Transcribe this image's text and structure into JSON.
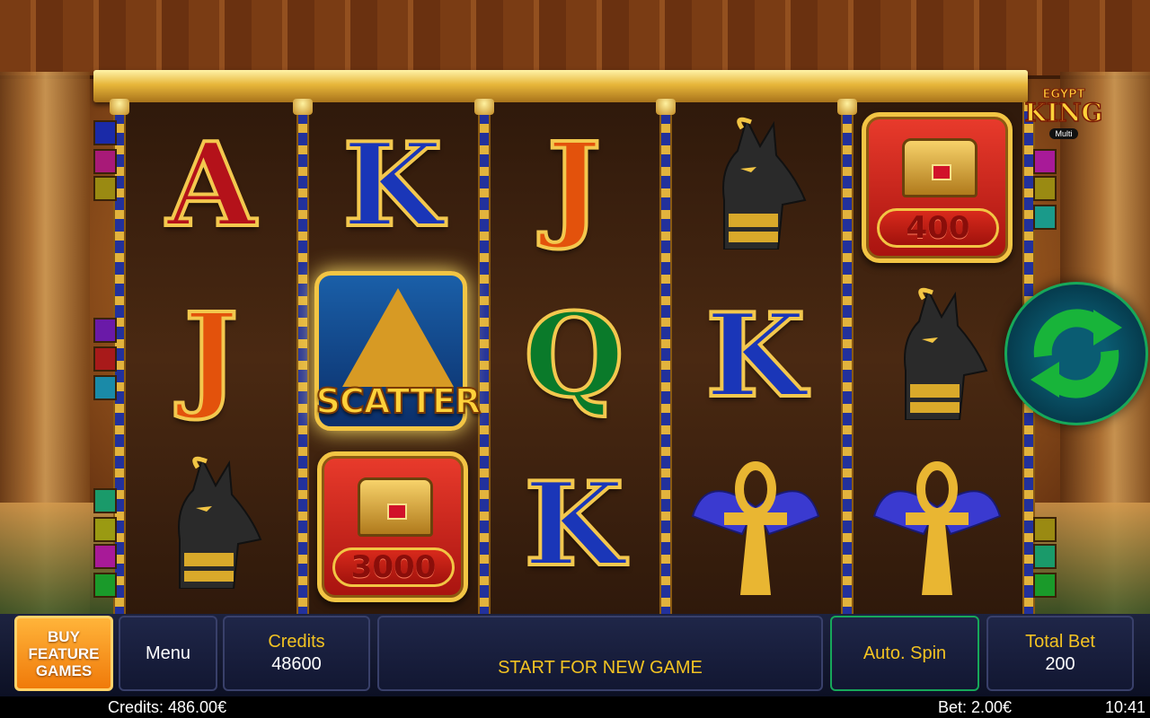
{
  "game": {
    "logo": {
      "line1": "EGYPT",
      "line2": "KING",
      "line3": "Multi"
    }
  },
  "reels": [
    [
      "A",
      "J",
      "anubis"
    ],
    [
      "K",
      "scatter",
      "chest"
    ],
    [
      "J",
      "Q",
      "K"
    ],
    [
      "anubis",
      "K",
      "ankh"
    ],
    [
      "chest",
      "anubis",
      "ankh"
    ]
  ],
  "symbols": {
    "scatter_label": "SCATTER",
    "chest_values": {
      "reel2": "3000",
      "reel5": "400"
    }
  },
  "controls": {
    "buy_feature": "BUY\nFEATURE\nGAMES",
    "menu": "Menu",
    "credits_label": "Credits",
    "credits_value": "48600",
    "message": "START FOR NEW GAME",
    "auto_spin": "Auto. Spin",
    "total_bet_label": "Total Bet",
    "total_bet_value": "200"
  },
  "status": {
    "credits": "Credits: 486.00€",
    "bet": "Bet: 2.00€",
    "time": "10:41"
  },
  "colors": {
    "accent_label": "#f3c322",
    "auto_spin_border": "#17a85a",
    "buy_feature_bg": "#f07a0a",
    "spin_arrow": "#18b43a"
  },
  "icons": {
    "spin": "circular-arrows-icon"
  }
}
